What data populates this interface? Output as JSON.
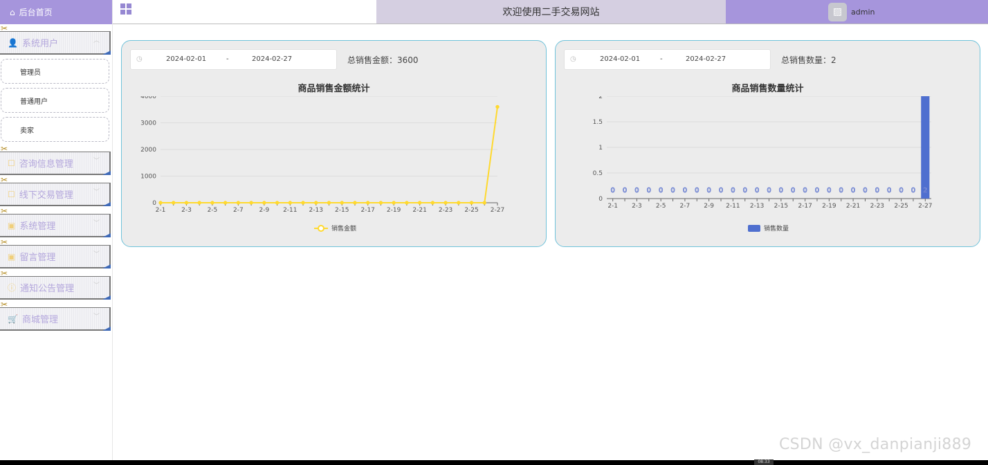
{
  "sidebar": {
    "home_label": "后台首页",
    "groups": [
      {
        "label": "系统用户",
        "icon": "user-icon"
      },
      {
        "label": "咨询信息管理",
        "icon": "edit-icon"
      },
      {
        "label": "线下交易管理",
        "icon": "edit-icon"
      },
      {
        "label": "系统管理",
        "icon": "image-icon"
      },
      {
        "label": "留言管理",
        "icon": "image-icon"
      },
      {
        "label": "通知公告管理",
        "icon": "info-icon"
      },
      {
        "label": "商城管理",
        "icon": "cart-icon"
      }
    ],
    "sub_items": [
      "管理员",
      "普通用户",
      "卖家"
    ]
  },
  "header": {
    "title": "欢迎使用二手交易网站",
    "username": "admin"
  },
  "cards": [
    {
      "start_date": "2024-02-01",
      "separator": "-",
      "end_date": "2024-02-27",
      "total_label": "总销售金额：3600"
    },
    {
      "start_date": "2024-02-01",
      "separator": "-",
      "end_date": "2024-02-27",
      "total_label": "总销售数量：2"
    }
  ],
  "chart_data": [
    {
      "type": "line",
      "title": "商品销售金额统计",
      "x": [
        "2-1",
        "2-2",
        "2-3",
        "2-4",
        "2-5",
        "2-6",
        "2-7",
        "2-8",
        "2-9",
        "2-10",
        "2-11",
        "2-12",
        "2-13",
        "2-14",
        "2-15",
        "2-16",
        "2-17",
        "2-18",
        "2-19",
        "2-20",
        "2-21",
        "2-22",
        "2-23",
        "2-24",
        "2-25",
        "2-26",
        "2-27"
      ],
      "x_tick_labels": [
        "2-1",
        "2-3",
        "2-5",
        "2-7",
        "2-9",
        "2-11",
        "2-13",
        "2-15",
        "2-17",
        "2-19",
        "2-21",
        "2-23",
        "2-25",
        "2-27"
      ],
      "series": [
        {
          "name": "销售金额",
          "values": [
            0,
            0,
            0,
            0,
            0,
            0,
            0,
            0,
            0,
            0,
            0,
            0,
            0,
            0,
            0,
            0,
            0,
            0,
            0,
            0,
            0,
            0,
            0,
            0,
            0,
            0,
            3600
          ],
          "color": "#ffd92e"
        }
      ],
      "y_ticks": [
        0,
        1000,
        2000,
        3000,
        4000
      ],
      "ylim": [
        0,
        4000
      ],
      "legend": "bottom-center",
      "grid": true
    },
    {
      "type": "bar",
      "title": "商品销售数量统计",
      "x": [
        "2-1",
        "2-2",
        "2-3",
        "2-4",
        "2-5",
        "2-6",
        "2-7",
        "2-8",
        "2-9",
        "2-10",
        "2-11",
        "2-12",
        "2-13",
        "2-14",
        "2-15",
        "2-16",
        "2-17",
        "2-18",
        "2-19",
        "2-20",
        "2-21",
        "2-22",
        "2-23",
        "2-24",
        "2-25",
        "2-26",
        "2-27"
      ],
      "x_tick_labels": [
        "2-1",
        "2-3",
        "2-5",
        "2-7",
        "2-9",
        "2-11",
        "2-13",
        "2-15",
        "2-17",
        "2-19",
        "2-21",
        "2-23",
        "2-25",
        "2-27"
      ],
      "series": [
        {
          "name": "销售数量",
          "values": [
            0,
            0,
            0,
            0,
            0,
            0,
            0,
            0,
            0,
            0,
            0,
            0,
            0,
            0,
            0,
            0,
            0,
            0,
            0,
            0,
            0,
            0,
            0,
            0,
            0,
            0,
            2
          ],
          "color": "#4f6fcf"
        }
      ],
      "y_ticks": [
        0,
        0.5,
        1,
        1.5,
        2
      ],
      "ylim": [
        0,
        2
      ],
      "legend": "bottom-center",
      "grid": true
    }
  ],
  "watermark": "CSDN @vx_danpianji889",
  "taskbar_time": "08:33"
}
